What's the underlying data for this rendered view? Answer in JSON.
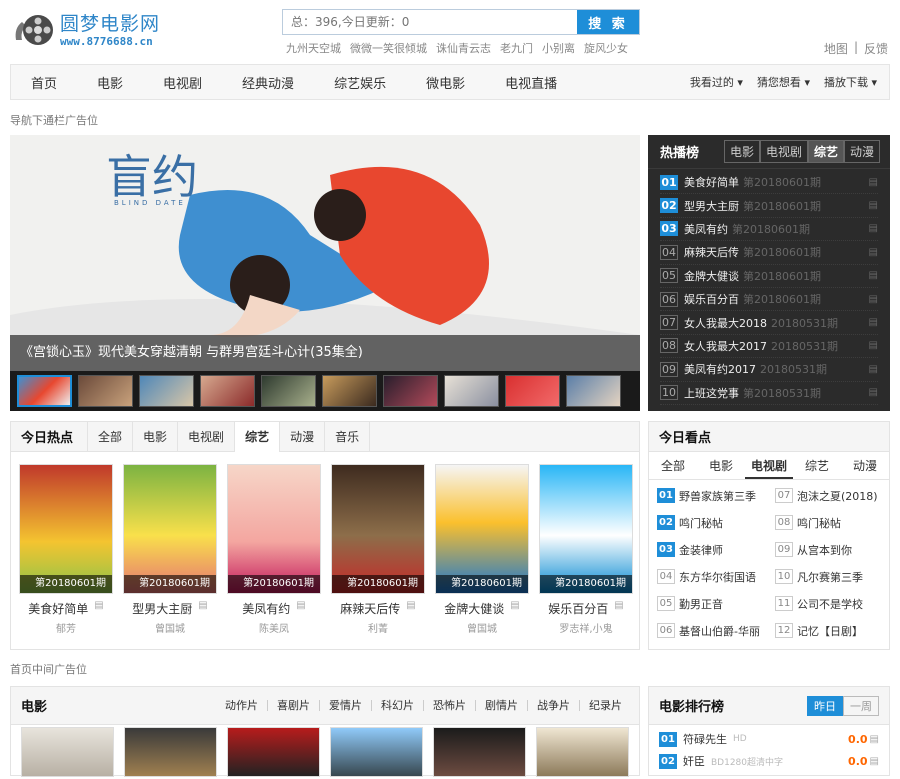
{
  "logo": {
    "name": "圆梦电影网",
    "url": "www.8776688.cn"
  },
  "search": {
    "placeholder": "总：396,今日更新：0",
    "button": "搜 索"
  },
  "hotwords": [
    "九州天空城",
    "微微一笑很倾城",
    "诛仙青云志",
    "老九门",
    "小别离",
    "旋风少女"
  ],
  "toplinks": {
    "map": "地图",
    "feedback": "反馈"
  },
  "nav": {
    "items": [
      "首页",
      "电影",
      "电视剧",
      "经典动漫",
      "综艺娱乐",
      "微电影",
      "电视直播"
    ],
    "right": [
      "我看过的",
      "猜您想看",
      "播放下载"
    ]
  },
  "ad1": "导航下通栏广告位",
  "banner": {
    "caption": "《宫锁心玉》现代美女穿越清朝 与群男宫廷斗心计(35集全)",
    "logo_text": "盲约",
    "logo_sub": "BLIND DATE"
  },
  "hot": {
    "title": "热播榜",
    "tabs": [
      "电影",
      "电视剧",
      "综艺",
      "动漫"
    ],
    "items": [
      {
        "n": "01",
        "t": "美食好简单",
        "e": "第20180601期"
      },
      {
        "n": "02",
        "t": "型男大主厨",
        "e": "第20180601期"
      },
      {
        "n": "03",
        "t": "美凤有约",
        "e": "第20180601期"
      },
      {
        "n": "04",
        "t": "麻辣天后传",
        "e": "第20180601期"
      },
      {
        "n": "05",
        "t": "金牌大健谈",
        "e": "第20180601期"
      },
      {
        "n": "06",
        "t": "娱乐百分百",
        "e": "第20180601期"
      },
      {
        "n": "07",
        "t": "女人我最大2018",
        "e": "20180531期"
      },
      {
        "n": "08",
        "t": "女人我最大2017",
        "e": "20180531期"
      },
      {
        "n": "09",
        "t": "美凤有约2017",
        "e": "20180531期"
      },
      {
        "n": "10",
        "t": "上班这党事",
        "e": "第20180531期"
      }
    ]
  },
  "today": {
    "title": "今日热点",
    "tabs": [
      "全部",
      "电影",
      "电视剧",
      "综艺",
      "动漫",
      "音乐"
    ],
    "items": [
      {
        "t": "美食好简单",
        "a": "郁芳",
        "b": "第20180601期"
      },
      {
        "t": "型男大主厨",
        "a": "曾国城",
        "b": "第20180601期"
      },
      {
        "t": "美凤有约",
        "a": "陈美凤",
        "b": "第20180601期"
      },
      {
        "t": "麻辣天后传",
        "a": "利菁",
        "b": "第20180601期"
      },
      {
        "t": "金牌大健谈",
        "a": "曾国城",
        "b": "第20180601期"
      },
      {
        "t": "娱乐百分百",
        "a": "罗志祥,小鬼",
        "b": "第20180601期"
      }
    ]
  },
  "look": {
    "title": "今日看点",
    "tabs": [
      "全部",
      "电影",
      "电视剧",
      "综艺",
      "动漫"
    ],
    "items": [
      {
        "n": "01",
        "t": "野兽家族第三季"
      },
      {
        "n": "07",
        "t": "泡沫之夏(2018)"
      },
      {
        "n": "02",
        "t": "鸣门秘帖"
      },
      {
        "n": "08",
        "t": "鸣门秘帖"
      },
      {
        "n": "03",
        "t": "金装律师"
      },
      {
        "n": "09",
        "t": "从宫本到你"
      },
      {
        "n": "04",
        "t": "东方华尔街国语"
      },
      {
        "n": "10",
        "t": "凡尔赛第三季"
      },
      {
        "n": "05",
        "t": "勤男正音"
      },
      {
        "n": "11",
        "t": "公司不是学校"
      },
      {
        "n": "06",
        "t": "基督山伯爵-华丽"
      },
      {
        "n": "12",
        "t": "记忆【日剧】"
      }
    ]
  },
  "ad2": "首页中间广告位",
  "movie": {
    "title": "电影",
    "cats": [
      "动作片",
      "喜剧片",
      "爱情片",
      "科幻片",
      "恐怖片",
      "剧情片",
      "战争片",
      "纪录片"
    ]
  },
  "mrank": {
    "title": "电影排行榜",
    "btns": [
      "昨日",
      "一周"
    ],
    "items": [
      {
        "n": "01",
        "t": "符碌先生",
        "q": "HD",
        "s": "0.0"
      },
      {
        "n": "02",
        "t": "奸臣",
        "q": "BD1280超清中字",
        "s": "0.0"
      }
    ]
  }
}
